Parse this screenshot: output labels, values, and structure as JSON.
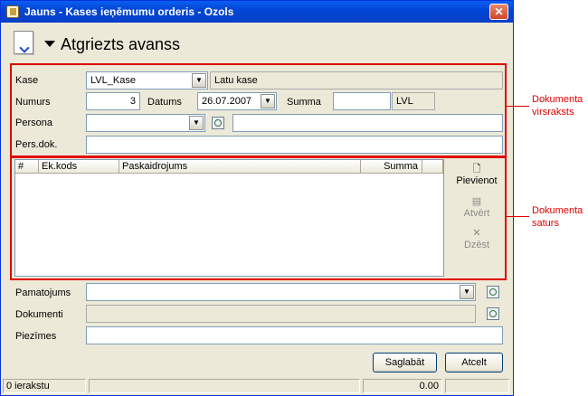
{
  "window": {
    "title": "Jauns - Kases ieņēmumu orderis - Ozols",
    "close": "✕"
  },
  "header": {
    "title": "Atgriezts avanss"
  },
  "form": {
    "kase_label": "Kase",
    "kase_value": "LVL_Kase",
    "kase_desc": "Latu kase",
    "numurs_label": "Numurs",
    "numurs_value": "3",
    "datums_label": "Datums",
    "datums_value": "26.07.2007",
    "summa_label": "Summa",
    "summa_value": "",
    "currency": "LVL",
    "persona_label": "Persona",
    "persona_value": "",
    "persona_desc": "",
    "persdok_label": "Pers.dok.",
    "persdok_value": ""
  },
  "grid": {
    "columns": [
      "#",
      "Ek.kods",
      "Paskaidrojums",
      "Summa"
    ],
    "rows": []
  },
  "side_buttons": {
    "add": "Pievienot",
    "open": "Atvērt",
    "delete": "Dzēst"
  },
  "bottom": {
    "pamatojums_label": "Pamatojums",
    "pamatojums_value": "",
    "dokumenti_label": "Dokumenti",
    "dokumenti_value": "",
    "piezimes_label": "Piezīmes",
    "piezimes_value": ""
  },
  "buttons": {
    "save": "Saglabāt",
    "cancel": "Atcelt"
  },
  "status": {
    "records": "0 ierakstu",
    "total": "0.00"
  },
  "annotations": {
    "header_line1": "Dokumenta",
    "header_line2": "virsraksts",
    "content_line1": "Dokumenta",
    "content_line2": "saturs",
    "color": "#e00000"
  }
}
